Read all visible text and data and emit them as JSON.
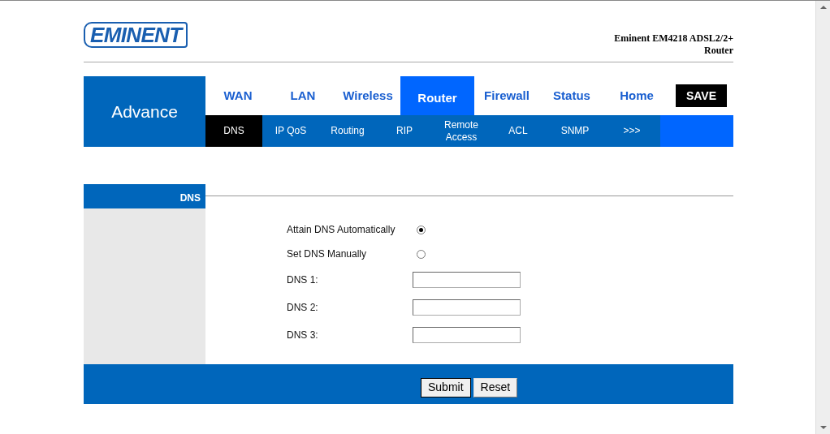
{
  "logo": "EMINENT",
  "product_title": [
    "Eminent EM4218 ADSL2/2+",
    "Router"
  ],
  "section": "Advance",
  "tabs": [
    {
      "label": "WAN",
      "selected": false
    },
    {
      "label": "LAN",
      "selected": false
    },
    {
      "label": "Wireless",
      "selected": false
    },
    {
      "label": "Router",
      "selected": true
    },
    {
      "label": "Firewall",
      "selected": false
    },
    {
      "label": "Status",
      "selected": false
    },
    {
      "label": "Home",
      "selected": false
    }
  ],
  "save_button": "SAVE",
  "subtabs": [
    {
      "label": "DNS",
      "selected": true
    },
    {
      "label": "IP QoS",
      "selected": false
    },
    {
      "label": "Routing",
      "selected": false
    },
    {
      "label": "RIP",
      "selected": false
    },
    {
      "label": "Remote Access",
      "selected": false
    },
    {
      "label": "ACL",
      "selected": false
    },
    {
      "label": "SNMP",
      "selected": false
    },
    {
      "label": ">>>",
      "selected": false
    }
  ],
  "sidebar_title": "DNS",
  "form": [
    {
      "kind": "radio",
      "label": "Attain DNS Automatically",
      "selected": true
    },
    {
      "kind": "radio",
      "label": "Set DNS Manually",
      "selected": false
    },
    {
      "kind": "text",
      "label": "DNS 1:"
    },
    {
      "kind": "text",
      "label": "DNS 2:"
    },
    {
      "kind": "text",
      "label": "DNS 3:"
    }
  ],
  "buttons": [
    "Submit",
    "Reset"
  ]
}
